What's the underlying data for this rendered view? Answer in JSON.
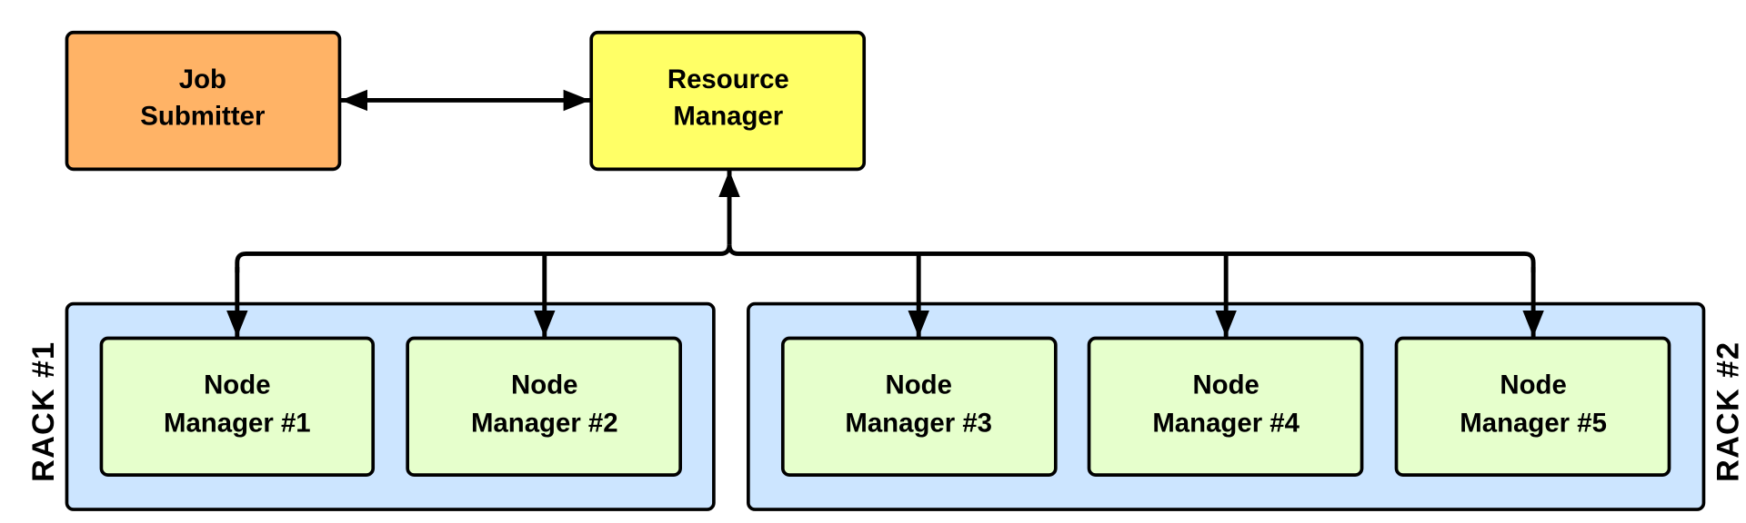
{
  "colors": {
    "job_submitter": "#FFB366",
    "resource_manager": "#FFFF66",
    "node_manager": "#E6FFCC",
    "rack": "#CCE5FF",
    "stroke": "#000000"
  },
  "job_submitter": {
    "line1": "Job",
    "line2": "Submitter"
  },
  "resource_manager": {
    "line1": "Resource",
    "line2": "Manager"
  },
  "racks": [
    {
      "label": "RACK #1"
    },
    {
      "label": "RACK #2"
    }
  ],
  "nodes": [
    {
      "line1": "Node",
      "line2": "Manager #1"
    },
    {
      "line1": "Node",
      "line2": "Manager #2"
    },
    {
      "line1": "Node",
      "line2": "Manager #3"
    },
    {
      "line1": "Node",
      "line2": "Manager #4"
    },
    {
      "line1": "Node",
      "line2": "Manager #5"
    }
  ],
  "connections": [
    {
      "from": "Job Submitter",
      "to": "Resource Manager",
      "direction": "both"
    },
    {
      "from": "Resource Manager",
      "to": "Node Manager #1",
      "direction": "both"
    },
    {
      "from": "Resource Manager",
      "to": "Node Manager #2",
      "direction": "both"
    },
    {
      "from": "Resource Manager",
      "to": "Node Manager #3",
      "direction": "both"
    },
    {
      "from": "Resource Manager",
      "to": "Node Manager #4",
      "direction": "both"
    },
    {
      "from": "Resource Manager",
      "to": "Node Manager #5",
      "direction": "both"
    }
  ]
}
